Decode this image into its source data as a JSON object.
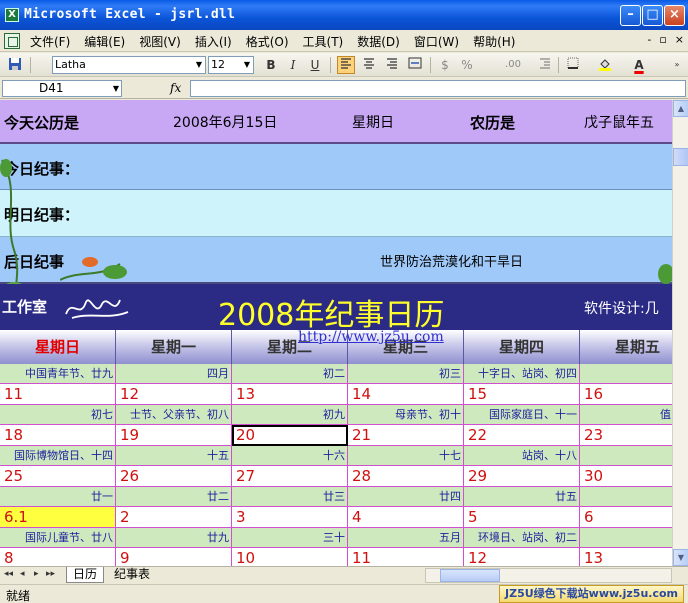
{
  "window": {
    "title": "Microsoft Excel - jsrl.dll",
    "app_icon": "X"
  },
  "menu": {
    "items": [
      "文件(F)",
      "编辑(E)",
      "视图(V)",
      "插入(I)",
      "格式(O)",
      "工具(T)",
      "数据(D)",
      "窗口(W)",
      "帮助(H)"
    ],
    "right_controls": [
      "-",
      "▫",
      "×"
    ]
  },
  "toolbar": {
    "font_name": "Latha",
    "font_size": "12",
    "bold": "B",
    "italic": "I",
    "underline": "U",
    "percent": "%",
    "font_color_glyph": "A",
    "accent_color": "#ffd27a"
  },
  "formula_bar": {
    "cell_ref": "D41",
    "fx": "fx",
    "value": ""
  },
  "sheet": {
    "today_solar_label": "今天公历是",
    "today_solar_date": "2008年6月15日",
    "today_weekday": "星期日",
    "lunar_label": "农历是",
    "lunar_value": "戊子鼠年五",
    "today_events_label": "今日纪事：",
    "tomorrow_events_label": "明日纪事：",
    "after_tomorrow_label": "后日纪事",
    "after_tomorrow_value": "世界防治荒漠化和干旱日",
    "studio_label": "工作室",
    "calendar_title": "2008年纪事日历",
    "designer_label": "软件设计:几",
    "url": "http://www.jz5u.com",
    "weekdays": [
      "星期日",
      "星期一",
      "星期二",
      "星期三",
      "星期四",
      "星期五"
    ],
    "rows": [
      {
        "sub": [
          "中国青年节、廿九",
          "四月",
          "初二",
          "初三",
          "十字日、站岗、初四",
          ""
        ],
        "days": [
          "11",
          "12",
          "13",
          "14",
          "15",
          "16"
        ]
      },
      {
        "sub": [
          "初七",
          "士节、父亲节、初八",
          "初九",
          "母亲节、初十",
          "国际家庭日、十一",
          "值日、"
        ],
        "days": [
          "18",
          "19",
          "20",
          "21",
          "22",
          "23"
        ]
      },
      {
        "sub": [
          "国际博物馆日、十四",
          "十五",
          "十六",
          "十七",
          "站岗、十八",
          ""
        ],
        "days": [
          "25",
          "26",
          "27",
          "28",
          "29",
          "30"
        ]
      },
      {
        "sub": [
          "廿一",
          "廿二",
          "廿三",
          "廿四",
          "廿五",
          ""
        ],
        "days": [
          "6.1",
          "2",
          "3",
          "4",
          "5",
          "6"
        ]
      },
      {
        "sub": [
          "国际儿童节、廿八",
          "廿九",
          "三十",
          "五月",
          "环境日、站岗、初二",
          ""
        ],
        "days": [
          "8",
          "9",
          "10",
          "11",
          "12",
          "13"
        ]
      }
    ],
    "highlight_cell": "6.1",
    "selected_cell": "20"
  },
  "tabs": {
    "items": [
      "日历",
      "纪事表"
    ],
    "active": "日历",
    "nav": [
      "◂◂",
      "◂",
      "▸",
      "▸▸"
    ]
  },
  "status": {
    "text": "就绪",
    "watermark": "JZ5U绿色下载站www.jz5u.com"
  }
}
